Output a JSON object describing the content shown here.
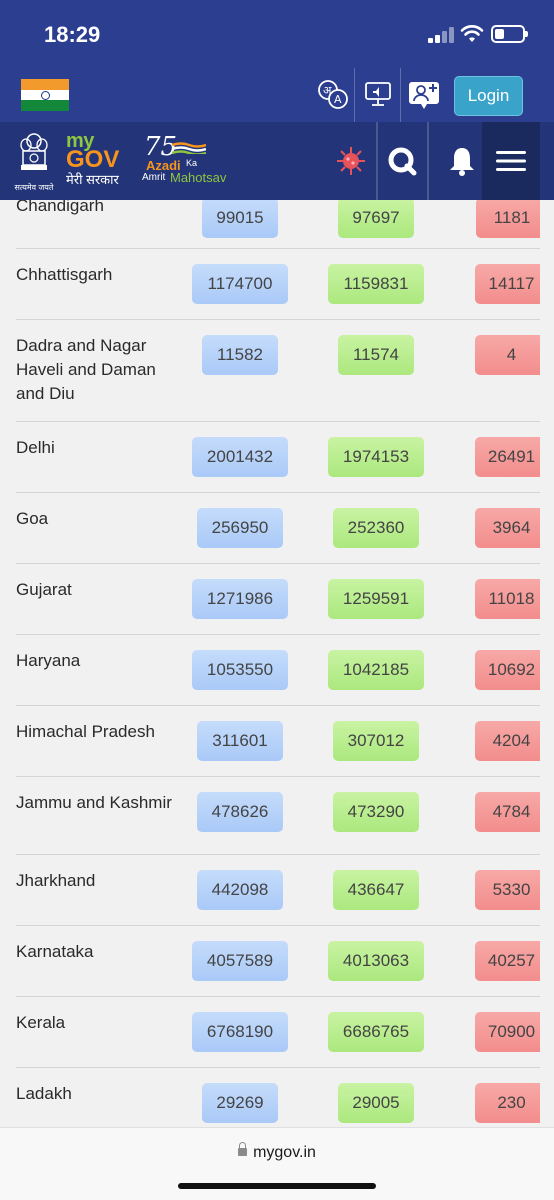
{
  "status_bar": {
    "time": "18:29"
  },
  "top_bar": {
    "login_label": "Login"
  },
  "nav": {
    "emblem_caption": "सत्यमेव जयते",
    "mygov_my": "my",
    "mygov_gov": "GOV",
    "mygov_subtitle": "मेरी सरकार",
    "azadi_number": "75",
    "azadi_line1": "Azadi",
    "azadi_ka": "Ka",
    "azadi_amrit": "Amrit",
    "azadi_mahotsav": "Mahotsav"
  },
  "table": {
    "rows": [
      {
        "state": "Chandigarh",
        "confirmed": "99015",
        "recovered": "97697",
        "deaths": "1181"
      },
      {
        "state": "Chhattisgarh",
        "confirmed": "1174700",
        "recovered": "1159831",
        "deaths": "14117"
      },
      {
        "state": "Dadra and Nagar Haveli and Daman and Diu",
        "confirmed": "11582",
        "recovered": "11574",
        "deaths": "4"
      },
      {
        "state": "Delhi",
        "confirmed": "2001432",
        "recovered": "1974153",
        "deaths": "26491"
      },
      {
        "state": "Goa",
        "confirmed": "256950",
        "recovered": "252360",
        "deaths": "3964"
      },
      {
        "state": "Gujarat",
        "confirmed": "1271986",
        "recovered": "1259591",
        "deaths": "11018"
      },
      {
        "state": "Haryana",
        "confirmed": "1053550",
        "recovered": "1042185",
        "deaths": "10692"
      },
      {
        "state": "Himachal Pradesh",
        "confirmed": "311601",
        "recovered": "307012",
        "deaths": "4204"
      },
      {
        "state": "Jammu and Kashmir",
        "confirmed": "478626",
        "recovered": "473290",
        "deaths": "4784"
      },
      {
        "state": "Jharkhand",
        "confirmed": "442098",
        "recovered": "436647",
        "deaths": "5330"
      },
      {
        "state": "Karnataka",
        "confirmed": "4057589",
        "recovered": "4013063",
        "deaths": "40257"
      },
      {
        "state": "Kerala",
        "confirmed": "6768190",
        "recovered": "6686765",
        "deaths": "70900"
      },
      {
        "state": "Ladakh",
        "confirmed": "29269",
        "recovered": "29005",
        "deaths": "230"
      }
    ]
  },
  "browser": {
    "url": "mygov.in"
  },
  "colors": {
    "header_bg": "#2c3e8f",
    "nav_bg": "#233578",
    "confirmed_pill": "#b4d1f8",
    "recovered_pill": "#b6ec88",
    "deaths_pill": "#f39a98",
    "login_button": "#3aa3c9"
  },
  "icons": {
    "translate": "translate-icon",
    "screen_reader": "screen-reader-icon",
    "add_user": "add-user-icon",
    "covid": "virus-icon",
    "search": "search-icon",
    "notifications": "bell-icon",
    "menu": "hamburger-menu-icon"
  }
}
